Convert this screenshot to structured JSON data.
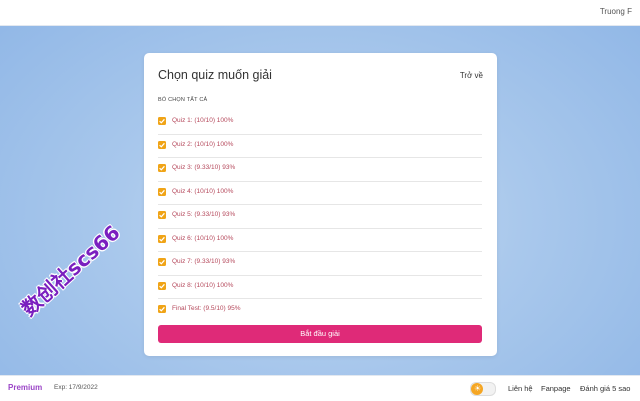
{
  "header": {
    "username": "Truong F"
  },
  "card": {
    "title": "Chọn quiz muốn giải",
    "back_label": "Trở về",
    "deselect_label": "BỎ CHỌN TẤT CẢ",
    "items": [
      {
        "label": "Quiz 1: (10/10) 100%",
        "checked": true
      },
      {
        "label": "Quiz 2: (10/10) 100%",
        "checked": true
      },
      {
        "label": "Quiz 3: (9.33/10) 93%",
        "checked": true
      },
      {
        "label": "Quiz 4: (10/10) 100%",
        "checked": true
      },
      {
        "label": "Quiz 5: (9.33/10) 93%",
        "checked": true
      },
      {
        "label": "Quiz 6: (10/10) 100%",
        "checked": true
      },
      {
        "label": "Quiz 7: (9.33/10) 93%",
        "checked": true
      },
      {
        "label": "Quiz 8: (10/10) 100%",
        "checked": true
      },
      {
        "label": "Final Test: (9.5/10) 95%",
        "checked": true
      }
    ],
    "start_label": "Bắt đầu giải"
  },
  "footer": {
    "premium": "Premium",
    "expiry": "Exp: 17/9/2022",
    "theme_toggle_icon": "sun-icon",
    "contact": "Liên hệ",
    "fanpage": "Fanpage",
    "rate": "Đánh giá 5 sao"
  },
  "watermark": "数创社scs66",
  "colors": {
    "accent": "#df2a78",
    "checkbox": "#f0a417",
    "item_text": "#b5485b",
    "premium": "#9b45c7"
  }
}
